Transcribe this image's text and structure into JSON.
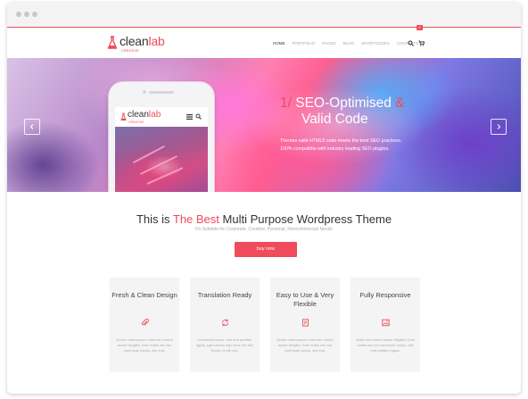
{
  "colors": {
    "accent": "#ef4b5c",
    "chrome": "#f3f3f3",
    "card": "#f4f4f4"
  },
  "header": {
    "logo": {
      "main": "clean",
      "accent": "lab",
      "tagline": "CREATIVE"
    },
    "nav": [
      "HOME",
      "PORTFOLIO",
      "PAGES",
      "BLOG",
      "SHORTCODES",
      "CONTACTS"
    ],
    "active_nav": "HOME",
    "icons": [
      "search-icon",
      "cart-icon"
    ],
    "cart_count": "0"
  },
  "hero": {
    "slide_number": "1/",
    "title_line1": "SEO-Optimised",
    "title_amp": "&",
    "title_line2": "Valid Code",
    "desc_line1": "Themes valid HTML5 code meets the best SEO practices.",
    "desc_line2": "100% compatible with industry leading SEO plugins.",
    "phone_logo": {
      "main": "clean",
      "accent": "lab",
      "tagline": "CREATIVE"
    },
    "prev_icon": "chevron-left-icon",
    "next_icon": "chevron-right-icon"
  },
  "intro": {
    "title_before": "This is ",
    "title_highlight": "The Best",
    "title_after": " Multi Purpose Wordpress Theme",
    "subtitle": "It's Suitable for Corporate, Creative, Personal, Noncommercial Needs",
    "button": "buy now"
  },
  "features": [
    {
      "title": "Fresh & Clean Design",
      "icon": "paperclip-icon",
      "desc": "Donec ullamcorper nulla non metus auctor fringilla. Duis mollis est non commodo luctus, nisi erat."
    },
    {
      "title": "Translation Ready",
      "icon": "refresh-icon",
      "desc": "Commodo luctus, nisi erat porttitor ligula, eget lacinia odio sem nec elit. Donec id elit non."
    },
    {
      "title": "Easy to Use & Very Flexible",
      "icon": "document-icon",
      "desc": "Donec ullamcorper nulla non metus auctor fringilla. Duis mollis est non commodo luctus, nisi erat."
    },
    {
      "title": "Fully Responsive",
      "icon": "image-icon",
      "desc": "Nulla non metus auctor fringilla. Duis mollis est non commodo luctus, nisi erat porttitor ligula."
    }
  ]
}
